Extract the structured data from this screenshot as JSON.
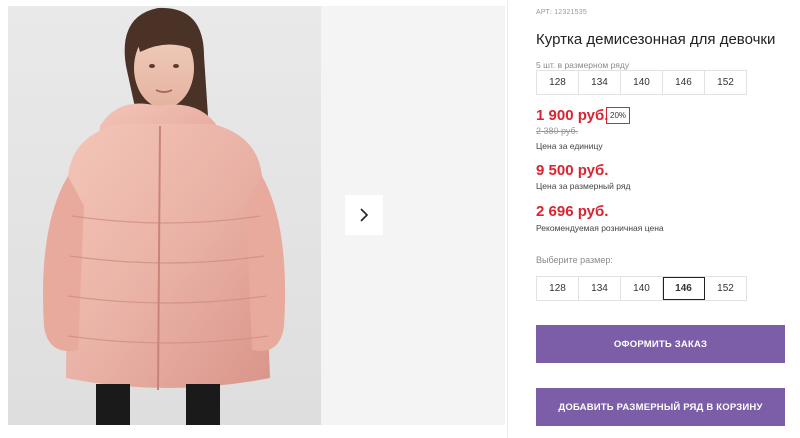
{
  "product": {
    "article": "АРТ: 12321535",
    "title": "Куртка демисезонная для девочки",
    "sizes_caption": "5 шт. в размерном ряду",
    "sizes": [
      "128",
      "134",
      "140",
      "146",
      "152"
    ],
    "selected_size": "146"
  },
  "prices": {
    "unit_price": "1 900 руб.",
    "discount": "20%",
    "old_price": "2 380 руб.",
    "unit_label": "Цена за единицу",
    "range_price": "9 500 руб.",
    "range_label": "Цена за размерный ряд",
    "retail_price": "2 696 руб.",
    "retail_label": "Рекомендуемая розничная цена"
  },
  "choose_size_label": "Выберите размер:",
  "buttons": {
    "order": "ОФОРМИТЬ ЗАКАЗ",
    "add_to_cart": "ДОБАВИТЬ РАЗМЕРНЫЙ РЯД В КОРЗИНУ"
  },
  "colors": {
    "accent_button": "#7b5ea7",
    "price_red": "#d92431"
  },
  "icons": {
    "next": "chevron-right-icon"
  }
}
